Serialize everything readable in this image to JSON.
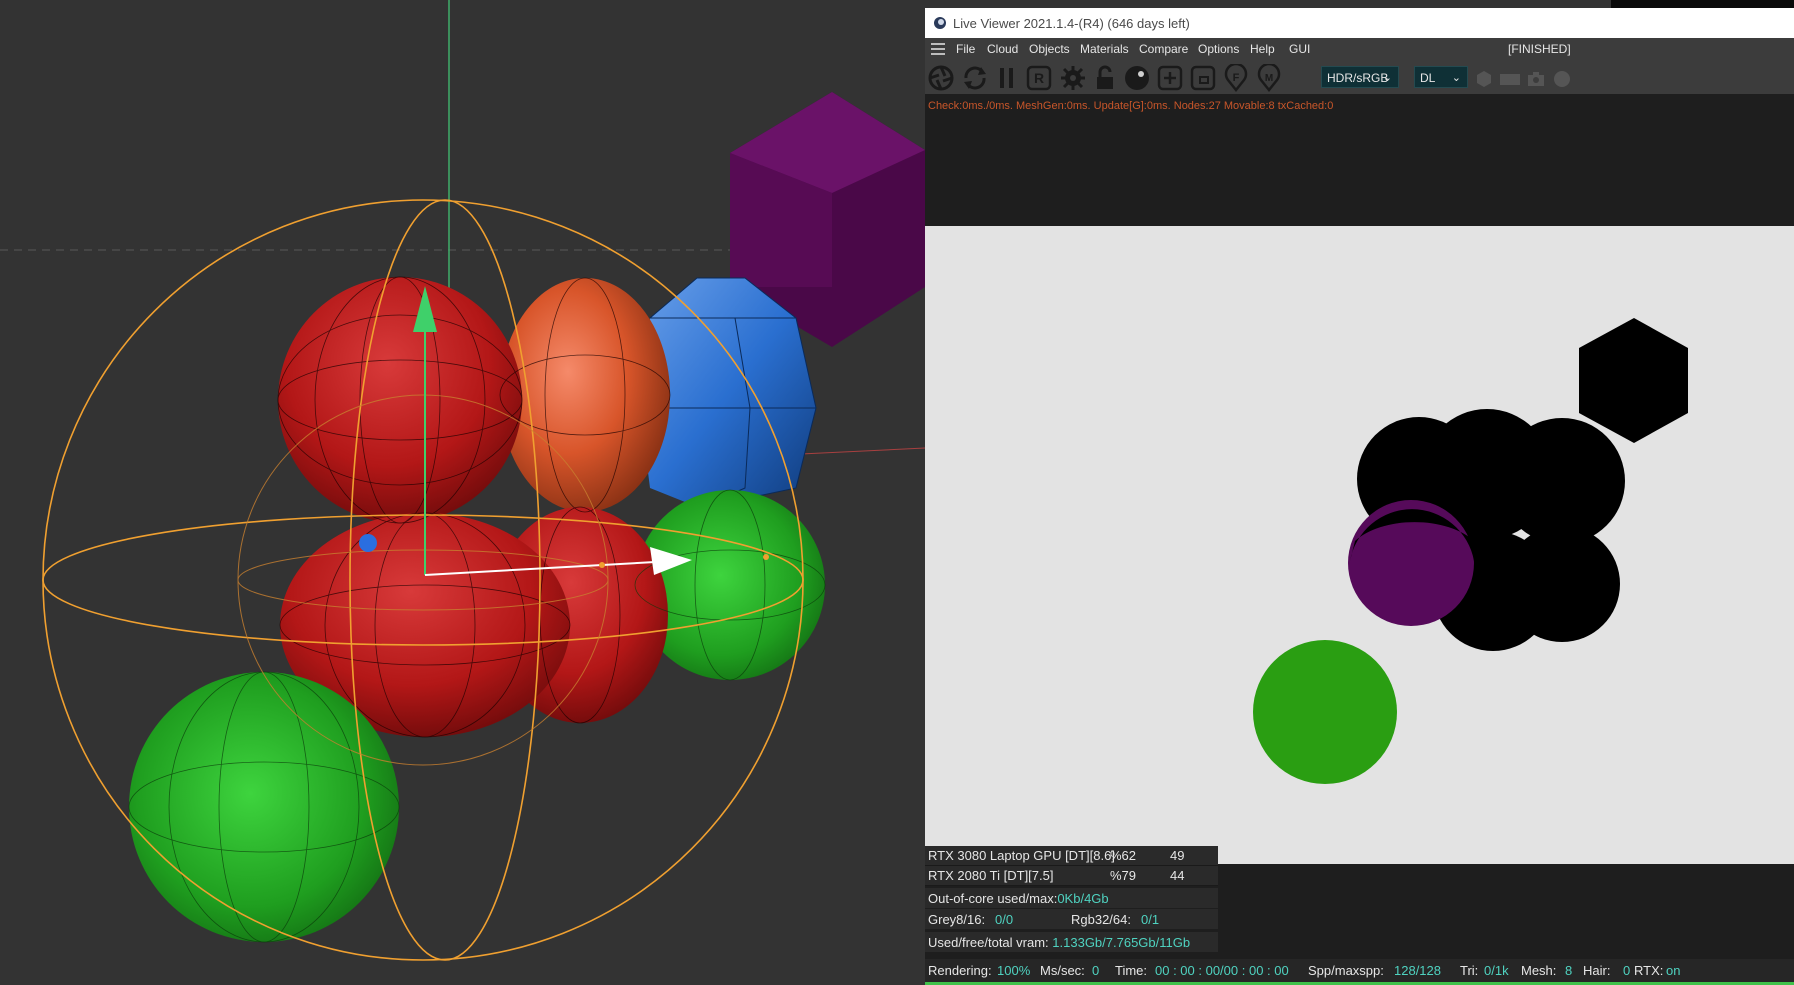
{
  "viewer": {
    "title": "Live Viewer 2021.1.4-(R4) (646 days left)",
    "menu": [
      "File",
      "Cloud",
      "Objects",
      "Materials",
      "Compare",
      "Options",
      "Help",
      "GUI"
    ],
    "status": "[FINISHED]",
    "toolbar": {
      "icons": [
        "aperture-icon",
        "refresh-icon",
        "pause-icon",
        "region-r-icon",
        "gear-icon",
        "lock-icon",
        "sphere-icon",
        "add-icon",
        "crop-icon",
        "focus-f-icon",
        "material-m-icon"
      ],
      "color_space_select": "HDR/sRGB",
      "mode_select": "DL"
    },
    "stats_line": "Check:0ms./0ms. MeshGen:0ms. Update[G]:0ms. Nodes:27 Movable:8 txCached:0"
  },
  "gpus": [
    {
      "name": "RTX 3080 Laptop GPU [DT][8.6]",
      "util": "%62",
      "temp": "49"
    },
    {
      "name": "RTX 2080 Ti [DT][7.5]",
      "util": "%79",
      "temp": "44"
    }
  ],
  "memory": {
    "out_of_core_label": "Out-of-core used/max:",
    "out_of_core_value": "0Kb/4Gb",
    "grey_label": "Grey8/16:",
    "grey_value": "0/0",
    "rgb_label": "Rgb32/64:",
    "rgb_value": "0/1",
    "vram_label": "Used/free/total vram:",
    "vram_value": "1.133Gb/7.765Gb/11Gb"
  },
  "status_bar": {
    "rendering_label": "Rendering:",
    "rendering_value": "100%",
    "ms_label": "Ms/sec:",
    "ms_value": "0",
    "time_label": "Time:",
    "time_value": "00 : 00 : 00/00 : 00 : 00",
    "spp_label": "Spp/maxspp:",
    "spp_value": "128/128",
    "tri_label": "Tri:",
    "tri_value": "0/1k",
    "mesh_label": "Mesh:",
    "mesh_value": "8",
    "hair_label": "Hair:",
    "hair_value": "0",
    "rtx_label": "RTX:",
    "rtx_value": "on",
    "progress_fraction": 1.0
  },
  "colors": {
    "accent_teal": "#4fd2c0",
    "stats_orange": "#c8562a",
    "select_bg": "#0f3036",
    "progress_green": "#3fc24a"
  }
}
